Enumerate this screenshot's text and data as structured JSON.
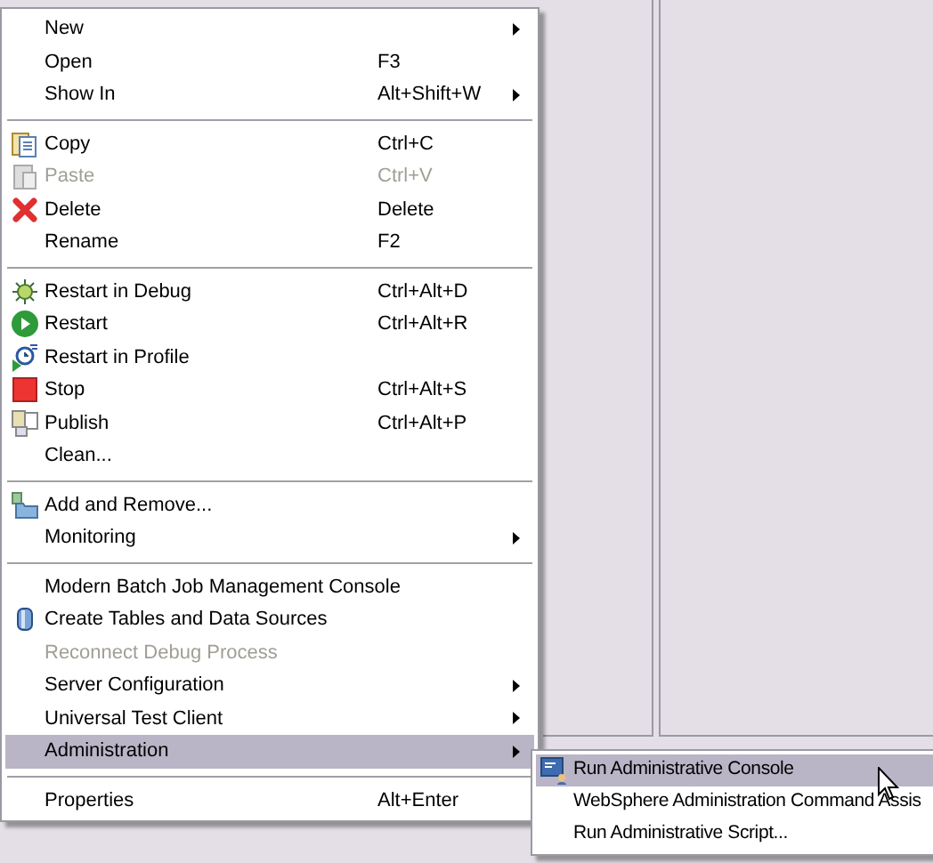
{
  "menu": {
    "items": [
      {
        "kind": "item",
        "label": "New",
        "submenu": true,
        "disabled": false,
        "selected": false
      },
      {
        "kind": "item",
        "label": "Open",
        "shortcut": "F3",
        "submenu": false,
        "disabled": false,
        "selected": false
      },
      {
        "kind": "item",
        "label": "Show In",
        "shortcut": "Alt+Shift+W",
        "submenu": true,
        "disabled": false,
        "selected": false
      },
      {
        "kind": "separator"
      },
      {
        "kind": "copy",
        "label": "Copy",
        "shortcut": "Ctrl+C",
        "submenu": false,
        "disabled": false,
        "selected": false
      },
      {
        "kind": "paste",
        "label": "Paste",
        "shortcut": "Ctrl+V",
        "submenu": false,
        "disabled": true,
        "selected": false
      },
      {
        "kind": "delete",
        "label": "Delete",
        "shortcut": "Delete",
        "submenu": false,
        "disabled": false,
        "selected": false
      },
      {
        "kind": "item",
        "label": "Rename",
        "shortcut": "F2",
        "submenu": false,
        "disabled": false,
        "selected": false
      },
      {
        "kind": "separator"
      },
      {
        "kind": "debug",
        "label": "Restart in Debug",
        "shortcut": "Ctrl+Alt+D",
        "submenu": false,
        "disabled": false,
        "selected": false
      },
      {
        "kind": "play",
        "label": "Restart",
        "shortcut": "Ctrl+Alt+R",
        "submenu": false,
        "disabled": false,
        "selected": false
      },
      {
        "kind": "profile",
        "label": "Restart in Profile",
        "submenu": false,
        "disabled": false,
        "selected": false
      },
      {
        "kind": "stop",
        "label": "Stop",
        "shortcut": "Ctrl+Alt+S",
        "submenu": false,
        "disabled": false,
        "selected": false
      },
      {
        "kind": "publish",
        "label": "Publish",
        "shortcut": "Ctrl+Alt+P",
        "submenu": false,
        "disabled": false,
        "selected": false
      },
      {
        "kind": "item",
        "label": "Clean...",
        "submenu": false,
        "disabled": false,
        "selected": false
      },
      {
        "kind": "separator"
      },
      {
        "kind": "folder",
        "label": "Add and Remove...",
        "submenu": false,
        "disabled": false,
        "selected": false
      },
      {
        "kind": "item",
        "label": "Monitoring",
        "submenu": true,
        "disabled": false,
        "selected": false
      },
      {
        "kind": "separator"
      },
      {
        "kind": "item",
        "label": "Modern Batch Job Management Console",
        "submenu": false,
        "disabled": false,
        "selected": false
      },
      {
        "kind": "database",
        "label": "Create Tables and Data Sources",
        "submenu": false,
        "disabled": false,
        "selected": false
      },
      {
        "kind": "item",
        "label": "Reconnect Debug Process",
        "submenu": false,
        "disabled": true,
        "selected": false
      },
      {
        "kind": "item",
        "label": "Server Configuration",
        "submenu": true,
        "disabled": false,
        "selected": false
      },
      {
        "kind": "item",
        "label": "Universal Test Client",
        "submenu": true,
        "disabled": false,
        "selected": false
      },
      {
        "kind": "item",
        "label": "Administration",
        "submenu": true,
        "disabled": false,
        "selected": true
      },
      {
        "kind": "separator"
      },
      {
        "kind": "item",
        "label": "Properties",
        "shortcut": "Alt+Enter",
        "submenu": false,
        "disabled": false,
        "selected": false
      }
    ]
  },
  "submenu": {
    "items": [
      {
        "kind": "console",
        "label": "Run Administrative Console",
        "selected": true
      },
      {
        "kind": "item",
        "label": "WebSphere Administration Command Assis",
        "selected": false
      },
      {
        "kind": "item",
        "label": "Run Administrative Script...",
        "selected": false
      }
    ]
  }
}
